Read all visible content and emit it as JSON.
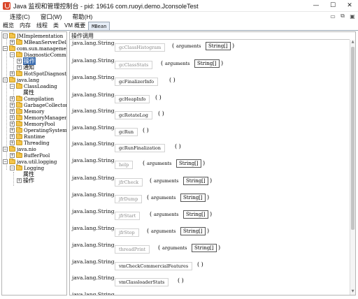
{
  "window": {
    "title": "Java 监视和管理控制台 - pid: 19616 com.ruoyi.demo.JconsoleTest",
    "minimize_glyph": "—",
    "maximize_glyph": "☐",
    "close_glyph": "✕"
  },
  "menu": {
    "items": [
      "连接(C)",
      "窗口(W)",
      "帮助(H)"
    ],
    "ctrl_glyphs": [
      "▭",
      "⧉",
      "▣"
    ]
  },
  "tabs": [
    "概览",
    "内存",
    "线程",
    "类",
    "VM 概要",
    "MBean"
  ],
  "tree": {
    "nodes": [
      {
        "label": "JMImplementation"
      },
      {
        "label": "MBeanServerDeleg"
      },
      {
        "label": "com.sun.management"
      },
      {
        "label": "DiagnosticCommand"
      },
      {
        "label": "操作"
      },
      {
        "label": "通知"
      },
      {
        "label": "HotSpotDiagnostic"
      },
      {
        "label": "java.lang"
      },
      {
        "label": "ClassLoading"
      },
      {
        "label": "属性"
      },
      {
        "label": "Compilation"
      },
      {
        "label": "GarbageCollector"
      },
      {
        "label": "Memory"
      },
      {
        "label": "MemoryManager"
      },
      {
        "label": "MemoryPool"
      },
      {
        "label": "OperatingSystem"
      },
      {
        "label": "Runtime"
      },
      {
        "label": "Threading"
      },
      {
        "label": "java.nio"
      },
      {
        "label": "BufferPool"
      },
      {
        "label": "java.util.logging"
      },
      {
        "label": "Logging"
      },
      {
        "label": "属性"
      },
      {
        "label": "操作"
      }
    ]
  },
  "main": {
    "panel_title": "操作调用",
    "operations": [
      {
        "ret": "java.lang.String",
        "name": "gcClassHistogram",
        "arg_label": "arguments",
        "arg_type": "String[]"
      },
      {
        "ret": "java.lang.String",
        "name": "gcClassStats",
        "arg_label": "arguments",
        "arg_type": "String[]"
      },
      {
        "ret": "java.lang.String",
        "name": "gcFinalizerInfo",
        "arg_label": "",
        "arg_type": ""
      },
      {
        "ret": "java.lang.String",
        "name": "gcHeapInfo",
        "arg_label": "",
        "arg_type": ""
      },
      {
        "ret": "java.lang.String",
        "name": "gcRotateLog",
        "arg_label": "",
        "arg_type": ""
      },
      {
        "ret": "java.lang.String",
        "name": "gcRun",
        "arg_label": "",
        "arg_type": ""
      },
      {
        "ret": "java.lang.String",
        "name": "gcRunFinalization",
        "arg_label": "",
        "arg_type": ""
      },
      {
        "ret": "java.lang.String",
        "name": "help",
        "arg_label": "arguments",
        "arg_type": "String[]"
      },
      {
        "ret": "java.lang.String",
        "name": "jfrCheck",
        "arg_label": "arguments",
        "arg_type": "String[]"
      },
      {
        "ret": "java.lang.String",
        "name": "jfrDump",
        "arg_label": "arguments",
        "arg_type": "String[]"
      },
      {
        "ret": "java.lang.String",
        "name": "jfrStart",
        "arg_label": "arguments",
        "arg_type": "String[]"
      },
      {
        "ret": "java.lang.String",
        "name": "jfrStop",
        "arg_label": "arguments",
        "arg_type": "String[]"
      },
      {
        "ret": "java.lang.String",
        "name": "threadPrint",
        "arg_label": "arguments",
        "arg_type": "String[]"
      },
      {
        "ret": "java.lang.String",
        "name": "vmCheckCommercialFeatures",
        "arg_label": "",
        "arg_type": ""
      },
      {
        "ret": "java.lang.String",
        "name": "vmClassloaderStats",
        "arg_label": "",
        "arg_type": ""
      },
      {
        "ret": "java.lang.String",
        "name": "",
        "arg_label": "",
        "arg_type": ""
      }
    ]
  }
}
